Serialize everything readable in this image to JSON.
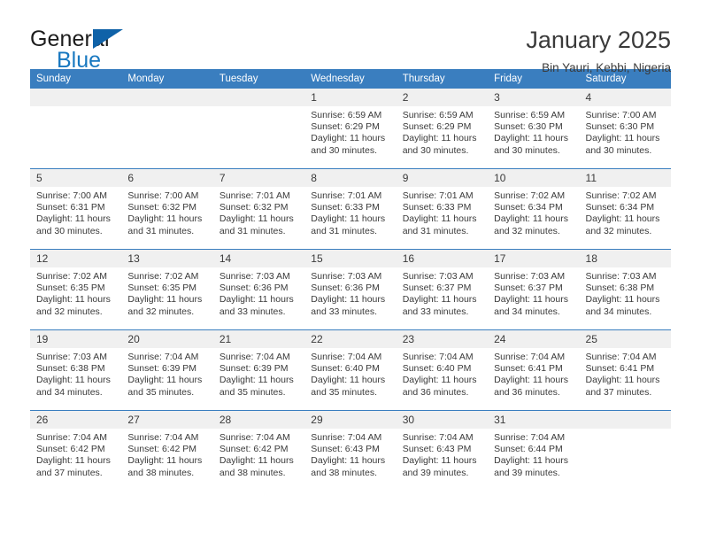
{
  "brand": {
    "word_one": "General",
    "word_two": "Blue",
    "triangle_icon": "blue-triangle-icon",
    "triangle_color": "#0f62a8",
    "accent_color": "#1878c0"
  },
  "header": {
    "title": "January 2025",
    "location": "Bin Yauri, Kebbi, Nigeria"
  },
  "calendar": {
    "header_bg": "#3a7ebf",
    "daynum_bg": "#f0f0f0",
    "weekday_headers": [
      "Sunday",
      "Monday",
      "Tuesday",
      "Wednesday",
      "Thursday",
      "Friday",
      "Saturday"
    ],
    "weeks": [
      [
        {
          "day": "",
          "sunrise": "",
          "sunset": "",
          "daylight_line1": "",
          "daylight_line2": ""
        },
        {
          "day": "",
          "sunrise": "",
          "sunset": "",
          "daylight_line1": "",
          "daylight_line2": ""
        },
        {
          "day": "",
          "sunrise": "",
          "sunset": "",
          "daylight_line1": "",
          "daylight_line2": ""
        },
        {
          "day": "1",
          "sunrise": "Sunrise: 6:59 AM",
          "sunset": "Sunset: 6:29 PM",
          "daylight_line1": "Daylight: 11 hours",
          "daylight_line2": "and 30 minutes."
        },
        {
          "day": "2",
          "sunrise": "Sunrise: 6:59 AM",
          "sunset": "Sunset: 6:29 PM",
          "daylight_line1": "Daylight: 11 hours",
          "daylight_line2": "and 30 minutes."
        },
        {
          "day": "3",
          "sunrise": "Sunrise: 6:59 AM",
          "sunset": "Sunset: 6:30 PM",
          "daylight_line1": "Daylight: 11 hours",
          "daylight_line2": "and 30 minutes."
        },
        {
          "day": "4",
          "sunrise": "Sunrise: 7:00 AM",
          "sunset": "Sunset: 6:30 PM",
          "daylight_line1": "Daylight: 11 hours",
          "daylight_line2": "and 30 minutes."
        }
      ],
      [
        {
          "day": "5",
          "sunrise": "Sunrise: 7:00 AM",
          "sunset": "Sunset: 6:31 PM",
          "daylight_line1": "Daylight: 11 hours",
          "daylight_line2": "and 30 minutes."
        },
        {
          "day": "6",
          "sunrise": "Sunrise: 7:00 AM",
          "sunset": "Sunset: 6:32 PM",
          "daylight_line1": "Daylight: 11 hours",
          "daylight_line2": "and 31 minutes."
        },
        {
          "day": "7",
          "sunrise": "Sunrise: 7:01 AM",
          "sunset": "Sunset: 6:32 PM",
          "daylight_line1": "Daylight: 11 hours",
          "daylight_line2": "and 31 minutes."
        },
        {
          "day": "8",
          "sunrise": "Sunrise: 7:01 AM",
          "sunset": "Sunset: 6:33 PM",
          "daylight_line1": "Daylight: 11 hours",
          "daylight_line2": "and 31 minutes."
        },
        {
          "day": "9",
          "sunrise": "Sunrise: 7:01 AM",
          "sunset": "Sunset: 6:33 PM",
          "daylight_line1": "Daylight: 11 hours",
          "daylight_line2": "and 31 minutes."
        },
        {
          "day": "10",
          "sunrise": "Sunrise: 7:02 AM",
          "sunset": "Sunset: 6:34 PM",
          "daylight_line1": "Daylight: 11 hours",
          "daylight_line2": "and 32 minutes."
        },
        {
          "day": "11",
          "sunrise": "Sunrise: 7:02 AM",
          "sunset": "Sunset: 6:34 PM",
          "daylight_line1": "Daylight: 11 hours",
          "daylight_line2": "and 32 minutes."
        }
      ],
      [
        {
          "day": "12",
          "sunrise": "Sunrise: 7:02 AM",
          "sunset": "Sunset: 6:35 PM",
          "daylight_line1": "Daylight: 11 hours",
          "daylight_line2": "and 32 minutes."
        },
        {
          "day": "13",
          "sunrise": "Sunrise: 7:02 AM",
          "sunset": "Sunset: 6:35 PM",
          "daylight_line1": "Daylight: 11 hours",
          "daylight_line2": "and 32 minutes."
        },
        {
          "day": "14",
          "sunrise": "Sunrise: 7:03 AM",
          "sunset": "Sunset: 6:36 PM",
          "daylight_line1": "Daylight: 11 hours",
          "daylight_line2": "and 33 minutes."
        },
        {
          "day": "15",
          "sunrise": "Sunrise: 7:03 AM",
          "sunset": "Sunset: 6:36 PM",
          "daylight_line1": "Daylight: 11 hours",
          "daylight_line2": "and 33 minutes."
        },
        {
          "day": "16",
          "sunrise": "Sunrise: 7:03 AM",
          "sunset": "Sunset: 6:37 PM",
          "daylight_line1": "Daylight: 11 hours",
          "daylight_line2": "and 33 minutes."
        },
        {
          "day": "17",
          "sunrise": "Sunrise: 7:03 AM",
          "sunset": "Sunset: 6:37 PM",
          "daylight_line1": "Daylight: 11 hours",
          "daylight_line2": "and 34 minutes."
        },
        {
          "day": "18",
          "sunrise": "Sunrise: 7:03 AM",
          "sunset": "Sunset: 6:38 PM",
          "daylight_line1": "Daylight: 11 hours",
          "daylight_line2": "and 34 minutes."
        }
      ],
      [
        {
          "day": "19",
          "sunrise": "Sunrise: 7:03 AM",
          "sunset": "Sunset: 6:38 PM",
          "daylight_line1": "Daylight: 11 hours",
          "daylight_line2": "and 34 minutes."
        },
        {
          "day": "20",
          "sunrise": "Sunrise: 7:04 AM",
          "sunset": "Sunset: 6:39 PM",
          "daylight_line1": "Daylight: 11 hours",
          "daylight_line2": "and 35 minutes."
        },
        {
          "day": "21",
          "sunrise": "Sunrise: 7:04 AM",
          "sunset": "Sunset: 6:39 PM",
          "daylight_line1": "Daylight: 11 hours",
          "daylight_line2": "and 35 minutes."
        },
        {
          "day": "22",
          "sunrise": "Sunrise: 7:04 AM",
          "sunset": "Sunset: 6:40 PM",
          "daylight_line1": "Daylight: 11 hours",
          "daylight_line2": "and 35 minutes."
        },
        {
          "day": "23",
          "sunrise": "Sunrise: 7:04 AM",
          "sunset": "Sunset: 6:40 PM",
          "daylight_line1": "Daylight: 11 hours",
          "daylight_line2": "and 36 minutes."
        },
        {
          "day": "24",
          "sunrise": "Sunrise: 7:04 AM",
          "sunset": "Sunset: 6:41 PM",
          "daylight_line1": "Daylight: 11 hours",
          "daylight_line2": "and 36 minutes."
        },
        {
          "day": "25",
          "sunrise": "Sunrise: 7:04 AM",
          "sunset": "Sunset: 6:41 PM",
          "daylight_line1": "Daylight: 11 hours",
          "daylight_line2": "and 37 minutes."
        }
      ],
      [
        {
          "day": "26",
          "sunrise": "Sunrise: 7:04 AM",
          "sunset": "Sunset: 6:42 PM",
          "daylight_line1": "Daylight: 11 hours",
          "daylight_line2": "and 37 minutes."
        },
        {
          "day": "27",
          "sunrise": "Sunrise: 7:04 AM",
          "sunset": "Sunset: 6:42 PM",
          "daylight_line1": "Daylight: 11 hours",
          "daylight_line2": "and 38 minutes."
        },
        {
          "day": "28",
          "sunrise": "Sunrise: 7:04 AM",
          "sunset": "Sunset: 6:42 PM",
          "daylight_line1": "Daylight: 11 hours",
          "daylight_line2": "and 38 minutes."
        },
        {
          "day": "29",
          "sunrise": "Sunrise: 7:04 AM",
          "sunset": "Sunset: 6:43 PM",
          "daylight_line1": "Daylight: 11 hours",
          "daylight_line2": "and 38 minutes."
        },
        {
          "day": "30",
          "sunrise": "Sunrise: 7:04 AM",
          "sunset": "Sunset: 6:43 PM",
          "daylight_line1": "Daylight: 11 hours",
          "daylight_line2": "and 39 minutes."
        },
        {
          "day": "31",
          "sunrise": "Sunrise: 7:04 AM",
          "sunset": "Sunset: 6:44 PM",
          "daylight_line1": "Daylight: 11 hours",
          "daylight_line2": "and 39 minutes."
        },
        {
          "day": "",
          "sunrise": "",
          "sunset": "",
          "daylight_line1": "",
          "daylight_line2": ""
        }
      ]
    ]
  }
}
